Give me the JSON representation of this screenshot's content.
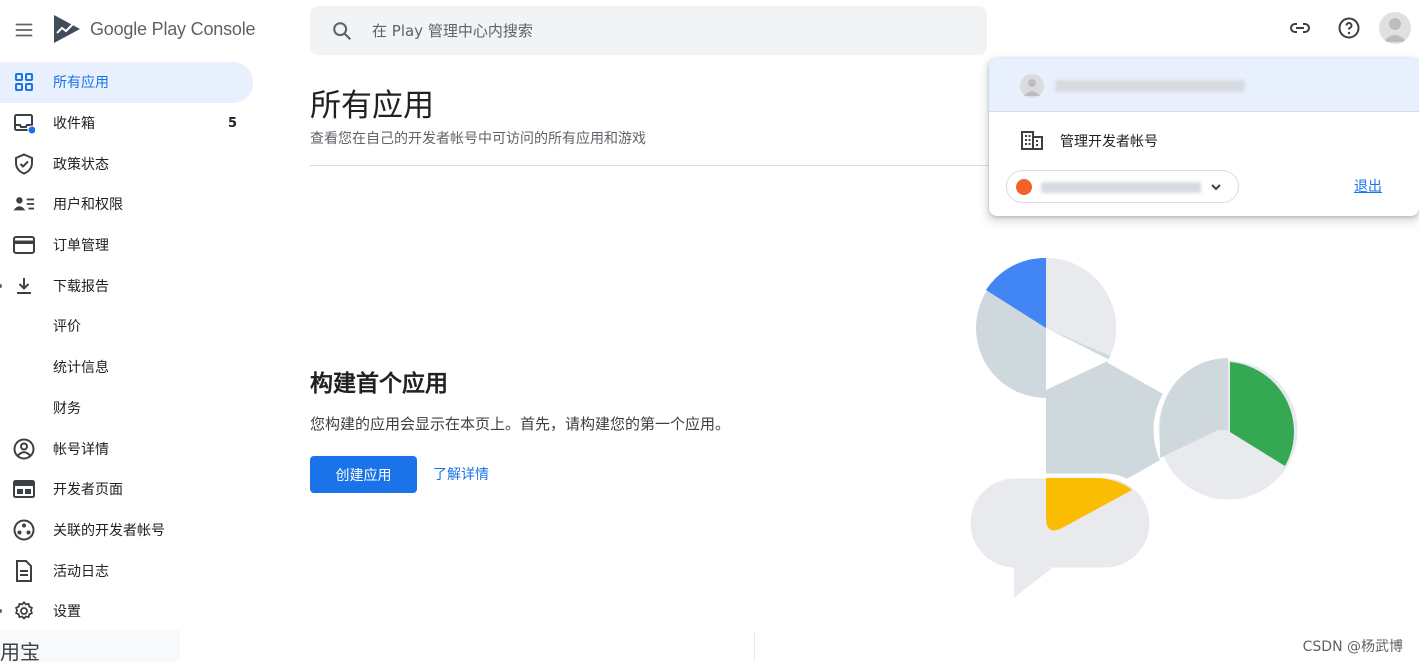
{
  "app": {
    "name": "Google Play Console"
  },
  "search": {
    "placeholder": "在 Play 管理中心内搜索"
  },
  "toolbar": {
    "link_icon": "link-icon",
    "help_icon": "help-icon",
    "account_icon": "account-avatar"
  },
  "sidebar": {
    "items": [
      {
        "label": "所有应用",
        "icon": "apps-grid-icon",
        "active": true
      },
      {
        "label": "收件箱",
        "icon": "inbox-icon",
        "count": "5",
        "notify_dot": true
      },
      {
        "label": "政策状态",
        "icon": "shield-check-icon"
      },
      {
        "label": "用户和权限",
        "icon": "user-list-icon"
      },
      {
        "label": "订单管理",
        "icon": "credit-card-icon"
      },
      {
        "label": "下载报告",
        "icon": "download-icon",
        "expandable": true
      },
      {
        "label": "评价",
        "sub": true
      },
      {
        "label": "统计信息",
        "sub": true
      },
      {
        "label": "财务",
        "sub": true
      },
      {
        "label": "帐号详情",
        "icon": "account-circle-icon"
      },
      {
        "label": "开发者页面",
        "icon": "web-page-icon"
      },
      {
        "label": "关联的开发者帐号",
        "icon": "linked-accounts-icon"
      },
      {
        "label": "活动日志",
        "icon": "document-icon"
      },
      {
        "label": "设置",
        "icon": "gear-icon",
        "expandable": true
      }
    ],
    "footer_fragment": "用宝"
  },
  "main": {
    "title": "所有应用",
    "subtitle": "查看您在自己的开发者帐号中可访问的所有应用和游戏",
    "empty_state": {
      "title": "构建首个应用",
      "description": "您构建的应用会显示在本页上。首先，请构建您的第一个应用。",
      "create_button": "创建应用",
      "learn_more": "了解详情"
    }
  },
  "account_menu": {
    "manage_developer_account": "管理开发者帐号",
    "sign_out": "退出"
  },
  "watermark": "CSDN @杨武博",
  "colors": {
    "accent": "#1a73e8",
    "active_bg": "#e8f0fe",
    "illustration_blue": "#4285f4",
    "illustration_green": "#34a853",
    "illustration_yellow": "#fbbc04",
    "illustration_gray": "#cfd8dc"
  }
}
